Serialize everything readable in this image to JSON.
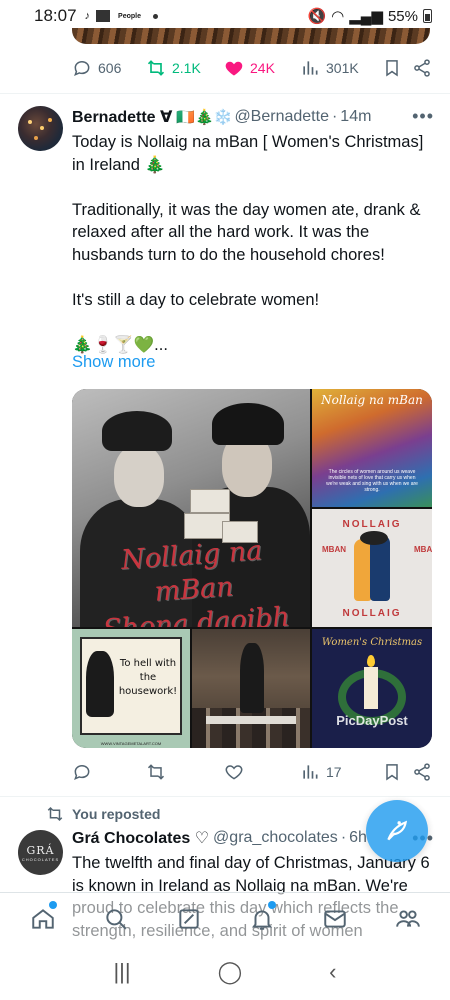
{
  "status_bar": {
    "time": "18:07",
    "mini_label": "People",
    "battery": "55%"
  },
  "prev_tweet": {
    "replies": "606",
    "reposts": "2.1K",
    "likes": "24K",
    "views": "301K"
  },
  "tweet": {
    "name": "Bernadette ∀",
    "name_emojis": "🇮🇪🎄❄️",
    "handle": "@Bernadette",
    "time": "14m",
    "text": "Today is Nollaig na mBan [ Women's Christmas] in Ireland 🎄\n\nTraditionally, it was the day women ate, drank & relaxed after all the hard work. It was the husbands turn to do the household chores!\n\nIt's still a day to celebrate women!\n\n🎄🍷🍸💚...",
    "show_more": "Show more",
    "collage": {
      "main_script": "Nollaig na mBan\nShona daoibh",
      "tile_r1_title": "Nollaig na mBan",
      "tile_r1_caption": "The circles of women around us weave invisible nets of love that carry us when we're weak and sing with us when we are strong.",
      "tile_r2_top": "NOLLAIG",
      "tile_r2_bottom": "NOLLAIG",
      "tile_r2_side": "MBAN",
      "tile_b1_text": "To hell with the housework!",
      "tile_b1_url": "WWW.VINTAGEMETALART.COM",
      "tile_b3_title": "Women's Christmas",
      "tile_b3_watermark": "PicDayPost"
    },
    "views": "17"
  },
  "repost": {
    "label": "You reposted",
    "avatar_text": "GRÁ",
    "avatar_sub": "CHOCOLATES",
    "name": "Grá Chocolates ♡",
    "handle": "@gra_chocolates",
    "time": "6h",
    "text": "The twelfth and final day of Christmas, January 6 is known in Ireland as Nollaig na mBan. We're proud to celebrate this day which reflects the strength, resilience, and spirit of women"
  },
  "colors": {
    "accent": "#1d9bf0",
    "like": "#f91880",
    "repost": "#00ba7c",
    "muted": "#536471"
  },
  "icons": {
    "reply": "reply-icon",
    "repost": "repost-icon",
    "like": "heart-icon",
    "views": "views-icon",
    "bookmark": "bookmark-icon",
    "share": "share-icon"
  }
}
